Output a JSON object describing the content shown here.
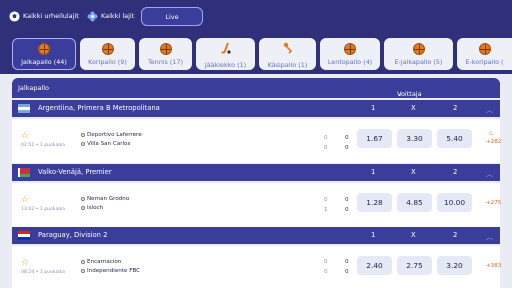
{
  "nav": {
    "all_sports": "Kaikki urheilulajit",
    "all_types": "Kaikki lajit",
    "live": "Live"
  },
  "sports": [
    {
      "label": "Jalkapallo (44)",
      "icon": "football-icon"
    },
    {
      "label": "Koripallo (9)",
      "icon": "basketball-icon"
    },
    {
      "label": "Tennis (17)",
      "icon": "tennis-icon"
    },
    {
      "label": "Jääkiekko (1)",
      "icon": "hockey-icon"
    },
    {
      "label": "Käsipallo (1)",
      "icon": "handball-icon"
    },
    {
      "label": "Lentopallo (4)",
      "icon": "volleyball-icon"
    },
    {
      "label": "E-jalkapallo (5)",
      "icon": "efootball-icon"
    },
    {
      "label": "E-koripallo (",
      "icon": "ebasketball-icon"
    }
  ],
  "table_header": {
    "sport": "Jalkapallo",
    "market": "Voittaja",
    "c1": "1",
    "cx": "X",
    "c2": "2"
  },
  "leagues": [
    {
      "name": "Argentiina, Primera B Metropolitana",
      "h1": "1",
      "hx": "X",
      "h2": "2",
      "flag": "argentina"
    },
    {
      "name": "Valko-Venäjä, Premier",
      "h1": "1",
      "hx": "X",
      "h2": "2",
      "flag": "belarus"
    },
    {
      "name": "Paraguay, Division 2",
      "h1": "1",
      "hx": "X",
      "h2": "2",
      "flag": "paraguay"
    }
  ],
  "matches": [
    {
      "time": "02:51 • 1 puoliaika",
      "home": "Deportivo Laferrere",
      "away": "Villa San Carlos",
      "s_home": "0",
      "s_away": "0",
      "p_home": "0",
      "p_away": "0",
      "o1": "1.67",
      "ox": "3.30",
      "o2": "5.40",
      "more": "+282"
    },
    {
      "time": "13:02 • 1 puoliaika",
      "home": "Neman Grodno",
      "away": "Isloch",
      "s_home": "0",
      "s_away": "0",
      "p_home": "0",
      "p_away": "1",
      "o1": "1.28",
      "ox": "4.85",
      "o2": "10.00",
      "more": "+275"
    },
    {
      "time": "08:24 • 1 puoliaika",
      "home": "Encarnacion",
      "away": "Independiente FBC",
      "s_home": "0",
      "s_away": "0",
      "p_home": "0",
      "p_away": "0",
      "o1": "2.40",
      "ox": "2.75",
      "o2": "3.20",
      "more": "+383"
    }
  ],
  "colors": {
    "primary": "#2f2f7a",
    "row_header": "#3a3d9a",
    "odds_bg": "#e5e8f5",
    "accent": "#e8662e"
  }
}
